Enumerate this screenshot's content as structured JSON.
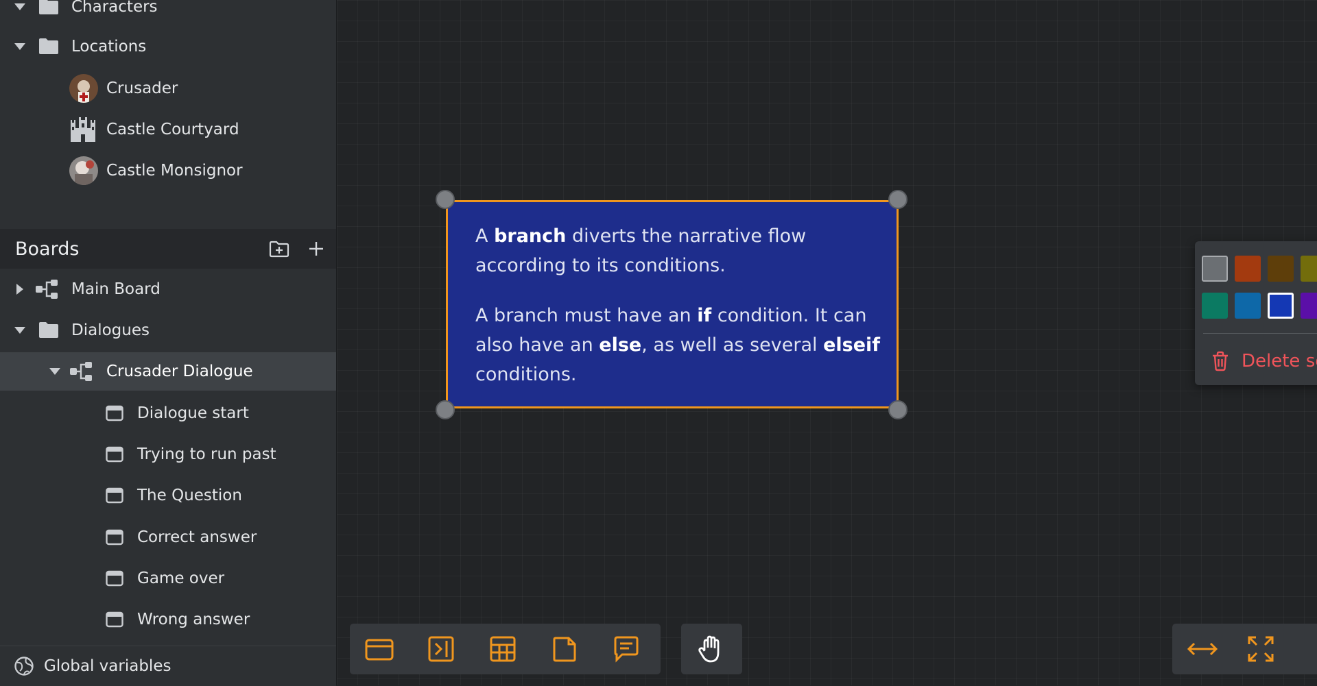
{
  "tree": {
    "characters": "Characters",
    "locations": "Locations",
    "location_items": [
      "Crusader",
      "Castle Courtyard",
      "Castle Monsignor"
    ]
  },
  "boards": {
    "title": "Boards",
    "main_board": "Main Board",
    "dialogues": "Dialogues",
    "crusader_dialogue": "Crusader Dialogue",
    "dialogue_items": [
      "Dialogue start",
      "Trying to run past",
      "The Question",
      "Correct answer",
      "Game over",
      "Wrong answer"
    ]
  },
  "global_variables": "Global variables",
  "note": {
    "p1": [
      "A ",
      "branch",
      " diverts the narrative flow according to its conditions."
    ],
    "p2": [
      "A branch must have an ",
      "if",
      " condition. It can also have an ",
      "else",
      ", as well as several ",
      "elseif",
      " conditions."
    ]
  },
  "context_menu": {
    "swatches": [
      "#6b6f73",
      "#a33a0f",
      "#5e3e0a",
      "#736d0b",
      "#4b8b12",
      "#0b5214",
      "#0b7a62",
      "#0e68a8",
      "#1438b4",
      "#5b0fa8",
      "#8a0f5e",
      "#7a1a0c"
    ],
    "selected_color": "#1438b4",
    "delete_label": "Delete selection"
  },
  "colors": {
    "accent": "#f0961e",
    "danger": "#f0545a",
    "note_bg": "#1e2d8c"
  },
  "toolbar_icons": [
    "card-icon",
    "jump-icon",
    "table-icon",
    "note-icon",
    "comment-icon",
    "hand-icon",
    "fit-width-icon",
    "fit-screen-icon"
  ]
}
